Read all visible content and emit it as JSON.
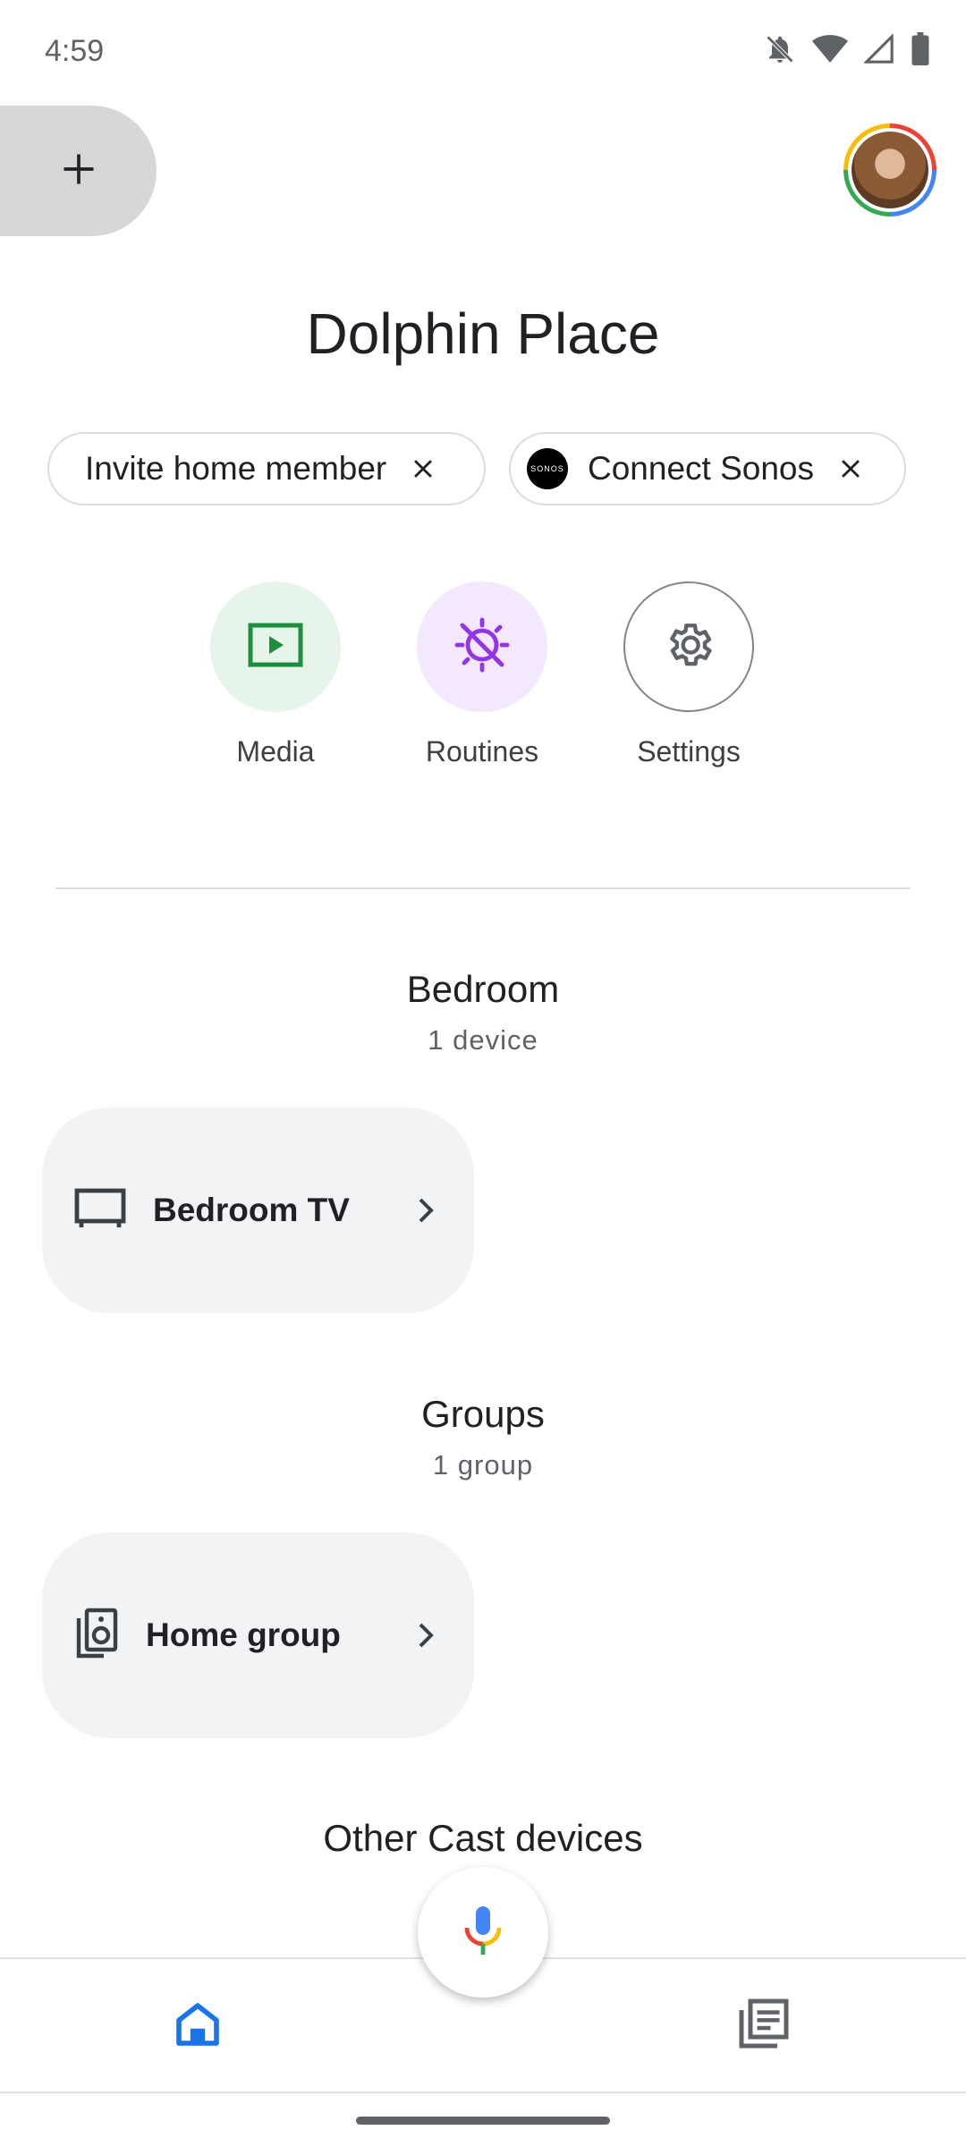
{
  "status_bar": {
    "time": "4:59",
    "icons": [
      "notifications-off-icon",
      "wifi-icon",
      "cell-signal-icon",
      "battery-icon"
    ]
  },
  "header": {
    "add_icon": "plus-icon",
    "avatar": "account-avatar"
  },
  "home": {
    "title": "Dolphin Place"
  },
  "chips": [
    {
      "label": "Invite home member",
      "icon": "close-icon"
    },
    {
      "label": "Connect Sonos",
      "logo_text": "SONOS",
      "icon": "close-icon"
    }
  ],
  "shortcuts": [
    {
      "label": "Media",
      "icon": "play-box-icon",
      "color": "#e6f4ea",
      "icon_color": "#1e8e3e"
    },
    {
      "label": "Routines",
      "icon": "routines-sun-icon",
      "color": "#f3e8fd",
      "icon_color": "#9334e6"
    },
    {
      "label": "Settings",
      "icon": "gear-icon",
      "color": "#ffffff",
      "icon_color": "#5f6368"
    }
  ],
  "sections": [
    {
      "title": "Bedroom",
      "subtitle": "1 device",
      "card": {
        "label": "Bedroom TV",
        "icon": "tv-icon"
      }
    },
    {
      "title": "Groups",
      "subtitle": "1 group",
      "card": {
        "label": "Home group",
        "icon": "speaker-group-icon"
      }
    },
    {
      "title": "Other Cast devices"
    }
  ],
  "bottom_nav": {
    "items": [
      {
        "name": "home",
        "icon": "home-icon",
        "active": true
      },
      {
        "name": "feed",
        "icon": "feed-icon",
        "active": false
      }
    ],
    "mic_icon": "microphone-icon"
  },
  "colors": {
    "accent": "#1a73e8",
    "card_bg": "#f1f3f4",
    "divider": "#dadce0"
  }
}
